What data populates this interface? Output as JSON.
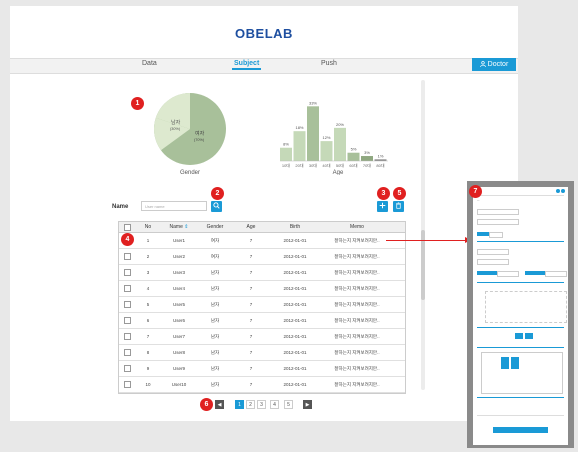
{
  "header": {
    "logo": "OBELAB"
  },
  "nav": {
    "tabs": [
      "Data",
      "Subject",
      "Push"
    ],
    "active_tab": "Subject",
    "doctor_label": "Doctor"
  },
  "badges": [
    "1",
    "2",
    "3",
    "4",
    "5",
    "6",
    "7"
  ],
  "gender_chart": {
    "caption": "Gender",
    "slices": [
      {
        "name": "남자",
        "percent_label": "(30%)",
        "value": 30,
        "color": "#dde9cf"
      },
      {
        "name": "여자",
        "percent_label": "(70%)",
        "value": 70,
        "color": "#a8c09a"
      }
    ]
  },
  "chart_data": {
    "type": "bar",
    "title": "",
    "xlabel": "Age",
    "ylabel": "",
    "categories": [
      "10대",
      "20대",
      "30대",
      "40대",
      "50대",
      "60대",
      "70대",
      "80대"
    ],
    "values": [
      8,
      18,
      33,
      12,
      20,
      5,
      3,
      1
    ],
    "value_labels": [
      "8%",
      "18%",
      "33%",
      "12%",
      "20%",
      "5%",
      "3%",
      "1%"
    ],
    "ylim": [
      0,
      35
    ],
    "colors": [
      "#c5d9b8",
      "#c5d9b8",
      "#a8c09a",
      "#c5d9b8",
      "#c5d9b8",
      "#a8c09a",
      "#8fa880",
      "#8a8a8a"
    ]
  },
  "search": {
    "label": "Name",
    "placeholder": "User name"
  },
  "table": {
    "headers": [
      "No",
      "Name",
      "Gender",
      "Age",
      "Birth",
      "Memo"
    ],
    "rows": [
      [
        "1",
        "User1",
        "여자",
        "7",
        "2012-01-01",
        "잘하는지 지켜보려지만.."
      ],
      [
        "2",
        "User2",
        "여자",
        "7",
        "2012-01-01",
        "잘하는지 지켜보려지만.."
      ],
      [
        "3",
        "User3",
        "남자",
        "7",
        "2012-01-01",
        "잘하는지 지켜보려지만.."
      ],
      [
        "4",
        "User4",
        "남자",
        "7",
        "2012-01-01",
        "잘하는지 지켜보려지만.."
      ],
      [
        "5",
        "User5",
        "남자",
        "7",
        "2012-01-01",
        "잘하는지 지켜보려지만.."
      ],
      [
        "6",
        "User6",
        "남자",
        "7",
        "2012-01-01",
        "잘하는지 지켜보려지만.."
      ],
      [
        "7",
        "User7",
        "남자",
        "7",
        "2012-01-01",
        "잘하는지 지켜보려지만.."
      ],
      [
        "8",
        "User8",
        "남자",
        "7",
        "2012-01-01",
        "잘하는지 지켜보려지만.."
      ],
      [
        "9",
        "User9",
        "남자",
        "7",
        "2012-01-01",
        "잘하는지 지켜보려지만.."
      ],
      [
        "10",
        "User10",
        "남자",
        "7",
        "2012-01-01",
        "잘하는지 지켜보려지만.."
      ]
    ]
  },
  "pagination": {
    "prev": "◀",
    "pages": [
      "1",
      "2",
      "3",
      "4",
      "5"
    ],
    "current": "1",
    "next": "▶"
  },
  "icons": {
    "add": "plus-icon",
    "delete": "trash-icon",
    "search": "search-icon",
    "user": "user-icon"
  },
  "colors": {
    "accent": "#1a9ad6",
    "badge": "#e02020",
    "logo": "#1e4fa0"
  }
}
